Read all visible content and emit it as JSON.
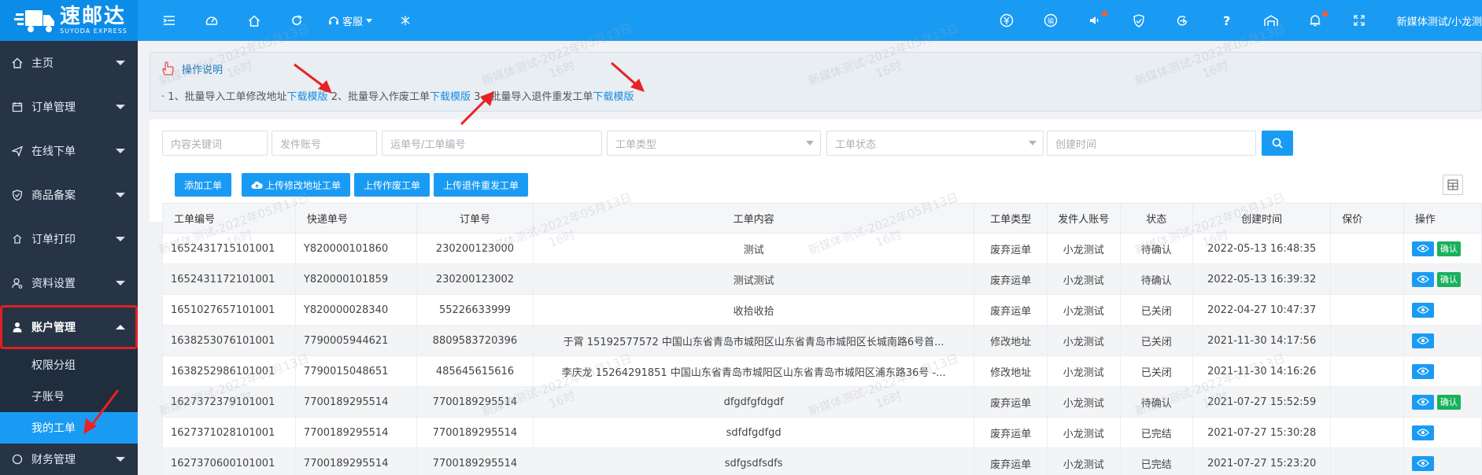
{
  "brand": {
    "cn": "速邮达",
    "en": "SUYODA EXPRESS"
  },
  "topbar": {
    "customer_service": "客服",
    "user": "新媒体测试/小龙测"
  },
  "sidebar": {
    "items": [
      {
        "label": "主页",
        "icon": "home-icon"
      },
      {
        "label": "订单管理",
        "icon": "calendar-icon"
      },
      {
        "label": "在线下单",
        "icon": "send-icon"
      },
      {
        "label": "商品备案",
        "icon": "shield-icon"
      },
      {
        "label": "订单打印",
        "icon": "printer-icon"
      },
      {
        "label": "资料设置",
        "icon": "user-settings-icon"
      },
      {
        "label": "账户管理",
        "icon": "user-icon"
      }
    ],
    "sub_items": [
      "权限分组",
      "子账号",
      "我的工单"
    ],
    "next_item": "财务管理"
  },
  "notice": {
    "title": "操作说明",
    "p1": "1、批量导入工单修改地址",
    "link1": "下载模版",
    "p2": " 2、批量导入作废工单",
    "link2": "下载模版",
    "p3": " 3、批量导入退件重发工单",
    "link3": "下载模版"
  },
  "filters": {
    "keyword": "内容关键词",
    "sender": "发件账号",
    "waybill": "运单号/工单编号",
    "type": "工单类型",
    "status": "工单状态",
    "created": "创建时间"
  },
  "actions": {
    "add": "添加工单",
    "upload_addr": "上传修改地址工单",
    "upload_void": "上传作废工单",
    "upload_return": "上传退件重发工单"
  },
  "table": {
    "headers": [
      "工单编号",
      "快递单号",
      "订单号",
      "工单内容",
      "工单类型",
      "发件人账号",
      "状态",
      "创建时间",
      "保价",
      "操作"
    ],
    "rows": [
      {
        "id": "1652431715101001",
        "express": "Y820000101860",
        "order": "230200123000",
        "content": "测试",
        "type": "废弃运单",
        "sender": "小龙测试",
        "status": "待确认",
        "time": "2022-05-13 16:48:35",
        "confirm": "确认"
      },
      {
        "id": "1652431172101001",
        "express": "Y820000101859",
        "order": "230200123002",
        "content": "测试测试",
        "type": "废弃运单",
        "sender": "小龙测试",
        "status": "待确认",
        "time": "2022-05-13 16:39:32",
        "confirm": "确认"
      },
      {
        "id": "1651027657101001",
        "express": "Y820000028340",
        "order": "55226633999",
        "content": "收拾收拾",
        "type": "废弃运单",
        "sender": "小龙测试",
        "status": "已关闭",
        "time": "2022-04-27 10:47:37",
        "confirm": ""
      },
      {
        "id": "1638253076101001",
        "express": "7790005944621",
        "order": "8809583720396",
        "content": "于霄 15192577572 中国山东省青岛市城阳区山东省青岛市城阳区长城南路6号首...",
        "type": "修改地址",
        "sender": "小龙测试",
        "status": "已关闭",
        "time": "2021-11-30 14:17:56",
        "confirm": ""
      },
      {
        "id": "1638252986101001",
        "express": "7790015048651",
        "order": "485645615616",
        "content": "李庆龙 15264291851 中国山东省青岛市城阳区山东省青岛市城阳区浦东路36号 -...",
        "type": "修改地址",
        "sender": "小龙测试",
        "status": "已关闭",
        "time": "2021-11-30 14:16:26",
        "confirm": ""
      },
      {
        "id": "1627372379101001",
        "express": "7700189295514",
        "order": "7700189295514",
        "content": "dfgdfgfdgdf",
        "type": "废弃运单",
        "sender": "小龙测试",
        "status": "待确认",
        "time": "2021-07-27 15:52:59",
        "confirm": "确认"
      },
      {
        "id": "1627371028101001",
        "express": "7700189295514",
        "order": "7700189295514",
        "content": "sdfdfgdfgd",
        "type": "废弃运单",
        "sender": "小龙测试",
        "status": "已完结",
        "time": "2021-07-27 15:30:28",
        "confirm": ""
      },
      {
        "id": "1627370600101001",
        "express": "7700189295514",
        "order": "7700189295514",
        "content": "sdfgsdfsdfs",
        "type": "废弃运单",
        "sender": "小龙测试",
        "status": "已完结",
        "time": "2021-07-27 15:23:20",
        "confirm": ""
      }
    ]
  },
  "watermark": {
    "line1": "新媒体测试-2022年05月13日",
    "line2": "16时"
  },
  "colors": {
    "primary": "#1a9bf3",
    "sidebar": "#263445",
    "confirm": "#19b15b",
    "highlight": "#e02020"
  }
}
